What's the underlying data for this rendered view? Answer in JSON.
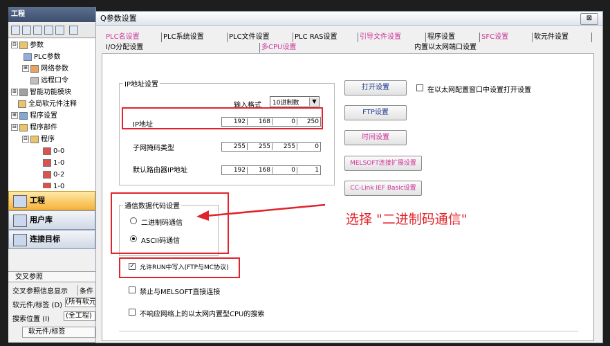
{
  "left_panel": {
    "title": "工程",
    "tree": [
      {
        "label": "参数",
        "exp": "⊟"
      },
      {
        "label": "PLC参数",
        "exp": ""
      },
      {
        "label": "网络参数",
        "exp": "⊞"
      },
      {
        "label": "远程口令",
        "exp": ""
      },
      {
        "label": "智能功能模块",
        "exp": "⊞"
      },
      {
        "label": "全局软元件注释",
        "exp": ""
      },
      {
        "label": "程序设置",
        "exp": "⊞"
      },
      {
        "label": "程序部件",
        "exp": "⊟"
      },
      {
        "label": "程序",
        "exp": "⊟"
      },
      {
        "label": "0-0",
        "exp": ""
      },
      {
        "label": "1-0",
        "exp": ""
      },
      {
        "label": "0-2",
        "exp": ""
      },
      {
        "label": "1-0",
        "exp": ""
      }
    ],
    "nav": [
      {
        "label": "工程"
      },
      {
        "label": "用户库"
      },
      {
        "label": "连接目标"
      }
    ],
    "crossref": {
      "title": "交叉参照",
      "tab1": "交叉参照信息显示",
      "tab2": "条件",
      "row1_label": "软元件/标签 (D)",
      "row1_value": "(所有软元",
      "row2_label": "搜索位置 (I)",
      "row2_value": "(全工程)",
      "col_header": "软元件/标签"
    }
  },
  "dialog": {
    "title": "Q参数设置",
    "close": "⊠",
    "tabs_row1": [
      {
        "label": "PLC名设置",
        "color": "pink"
      },
      {
        "label": "PLC系统设置",
        "color": "black"
      },
      {
        "label": "PLC文件设置",
        "color": "black"
      },
      {
        "label": "PLC RAS设置",
        "color": "black"
      },
      {
        "label": "引导文件设置",
        "color": "pink"
      },
      {
        "label": "程序设置",
        "color": "black"
      },
      {
        "label": "SFC设置",
        "color": "pink"
      },
      {
        "label": "软元件设置",
        "color": "black"
      }
    ],
    "tabs_row2": [
      {
        "label": "I/O分配设置",
        "color": "black"
      },
      {
        "label": "多CPU设置",
        "color": "pink"
      },
      {
        "label": "内置以太网端口设置",
        "color": "black"
      }
    ],
    "ip_group": {
      "title": "IP地址设置",
      "input_format_label": "输入格式",
      "input_format_value": "10进制数",
      "ip_label": "IP地址",
      "ip": [
        "192",
        "168",
        "0",
        "250"
      ],
      "subnet_label": "子网掩码类型",
      "subnet": [
        "255",
        "255",
        "255",
        "0"
      ],
      "gateway_label": "默认路由器IP地址",
      "gateway": [
        "192",
        "168",
        "0",
        "1"
      ]
    },
    "buttons": {
      "open_settings": "打开设置",
      "ftp_settings": "FTP设置",
      "time_settings": "时间设置",
      "melsoft_ext": "MELSOFT连接扩展设置",
      "cclink": "CC-Link IEF Basic设置"
    },
    "open_in_network": "在以太网配置窗口中设置打开设置",
    "comm_group": {
      "title": "通信数据代码设置",
      "binary": "二进制码通信",
      "ascii": "ASCII码通信",
      "selected": "ascii"
    },
    "checks": {
      "allow_run_write": "允许RUN中写入(FTP与MC协议)",
      "disable_melsoft": "禁止与MELSOFT直接连接",
      "no_respond_search": "不响应网络上的以太网内置型CPU的搜索"
    }
  },
  "annotation": {
    "text": "选择 \"二进制码通信\"",
    "color": "#e0242b"
  },
  "colors": {
    "accent_pink": "#cc3399",
    "annotation_red": "#e0242b",
    "nav_active": "#f6b23b"
  }
}
